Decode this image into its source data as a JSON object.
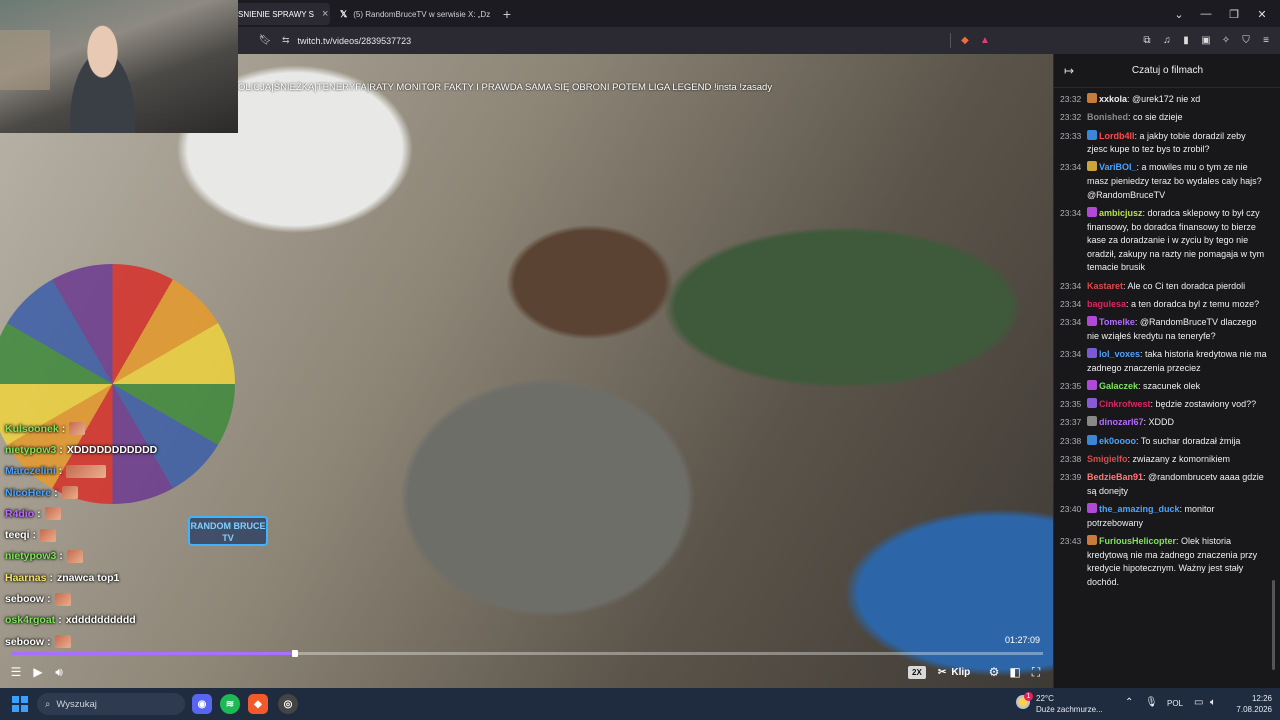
{
  "browser": {
    "tabs": [
      {
        "label": "SNIENIE SPRAWY S",
        "active": true
      },
      {
        "label": "(5) RandomBruceTV w serwisie X: „Dz",
        "active": false
      }
    ],
    "url": "twitch.tv/videos/2839537723",
    "new_tab": "+",
    "icons": [
      "bookmark-icon",
      "site-info-icon",
      "brave-shield-icon",
      "rewards-icon",
      "extensions-icon",
      "media-icon",
      "sidebar-icon",
      "wallet-icon",
      "leo-icon",
      "vpn-icon",
      "menu-icon"
    ]
  },
  "video": {
    "title": "OLICJA|ŚNIEŻKA|TENERYFA|RATY MONITOR FAKTY I PRAWDA SAMA SIĘ OBRONI POTEM LIGA LEGEND !insta !zasady",
    "neon_sign": "RANDOM BRUCE TV",
    "timestamp": "01:27:09",
    "progress_fraction": 0.275,
    "speed": "2X",
    "clip_label": "Klip",
    "overlay_chat": [
      {
        "name": "Kulsoonek",
        "color": "#7fe35c",
        "msg": "",
        "emote": "small"
      },
      {
        "name": "nietypow3",
        "color": "#7fe35c",
        "msg": "XDDDDDDDDDDD",
        "emote": ""
      },
      {
        "name": "Marczelini",
        "color": "#4aa3ff",
        "msg": "",
        "emote": "wide"
      },
      {
        "name": "NicoHere",
        "color": "#4aa3ff",
        "msg": "",
        "emote": "small"
      },
      {
        "name": "R4dio",
        "color": "#b76cff",
        "msg": "",
        "emote": "small"
      },
      {
        "name": "teeqi",
        "color": "#ffffff",
        "msg": "",
        "emote": "small"
      },
      {
        "name": "nietypow3",
        "color": "#7fe35c",
        "msg": "",
        "emote": "small"
      },
      {
        "name": "Haarnas",
        "color": "#f5e56b",
        "msg": "znawca top1",
        "emote": ""
      },
      {
        "name": "seboow",
        "color": "#ffffff",
        "msg": "",
        "emote": "small"
      },
      {
        "name": "osk4rgoat",
        "color": "#7fe35c",
        "msg": "xdddddddddd",
        "emote": ""
      },
      {
        "name": "seboow",
        "color": "#ffffff",
        "msg": "",
        "emote": "small"
      }
    ]
  },
  "chat_panel": {
    "header": "Czatuj o filmach",
    "messages": [
      {
        "time": "23:32",
        "user": "xxkola",
        "color": "#efeff1",
        "badge": "#c97b3a",
        "text": "@urek172 nie xd"
      },
      {
        "time": "23:32",
        "user": "Bonished",
        "color": "#8a8a8a",
        "badge": "",
        "text": "co sie dzieje"
      },
      {
        "time": "23:33",
        "user": "Lordb4ll",
        "color": "#ff4b4b",
        "badge": "#3b86d6",
        "text": "a jakby tobie doradzil zeby zjesc kupe to tez bys to zrobil?"
      },
      {
        "time": "23:34",
        "user": "VariBOI_",
        "color": "#4aa3ff",
        "badge": "#caa53a",
        "text": "a mowiles mu o tym ze nie masz pieniedzy teraz bo wydales caly hajs? @RandomBruceTV"
      },
      {
        "time": "23:34",
        "user": "ambicjusz",
        "color": "#b8e04a",
        "badge": "#b04ad6",
        "text": "doradca sklepowy to był czy finansowy, bo doradca finansowy to bierze kase za doradzanie i w zyciu by tego nie oradził, zakupy na razty nie pomagaja w tym temacie brusik"
      },
      {
        "time": "23:34",
        "user": "Kastaret",
        "color": "#d94a4a",
        "badge": "",
        "text": "Ale co Ci ten doradca pierdoli"
      },
      {
        "time": "23:34",
        "user": "bagulesa",
        "color": "#e0245e",
        "badge": "",
        "text": "a ten doradca byl z temu moze?"
      },
      {
        "time": "23:34",
        "user": "Tomelke",
        "color": "#b46bff",
        "badge": "#b04ad6",
        "text": "@RandomBruceTV dlaczego nie wziąłeś kredytu na teneryfe?"
      },
      {
        "time": "23:34",
        "user": "lol_voxes",
        "color": "#4aa3ff",
        "badge": "#7a5bd6",
        "text": "taka historia kredytowa nie ma zadnego znaczenia przeciez"
      },
      {
        "time": "23:35",
        "user": "Galaczek",
        "color": "#7fe35c",
        "badge": "#b04ad6",
        "text": "szacunek olek"
      },
      {
        "time": "23:35",
        "user": "Cinkrofwest",
        "color": "#e0245e",
        "badge": "#8a5bd6",
        "text": "będzie zostawiony vod??"
      },
      {
        "time": "23:37",
        "user": "dinozarl67",
        "color": "#b46bff",
        "badge": "#888888",
        "text": "XDDD"
      },
      {
        "time": "23:38",
        "user": "ek0oooo",
        "color": "#4aa3ff",
        "badge": "#3b86d6",
        "text": "To suchar doradzał żmija"
      },
      {
        "time": "23:38",
        "user": "Smigielfo",
        "color": "#d94a4a",
        "badge": "",
        "text": "zwiazany z komornikiem"
      },
      {
        "time": "23:39",
        "user": "BedzieBan91",
        "color": "#ff7a7a",
        "badge": "",
        "text": "@randombrucetv aaaa gdzie są donejty"
      },
      {
        "time": "23:40",
        "user": "the_amazing_duck",
        "color": "#4aa3ff",
        "badge": "#b04ad6",
        "text": "monitor potrzebowany"
      },
      {
        "time": "23:43",
        "user": "FuriousHelicopter",
        "color": "#7fe35c",
        "badge": "#c97b3a",
        "text": "Olek historia kredytową nie ma żadnego znaczenia przy kredycie hipotecznym. Ważny jest stały dochód."
      }
    ]
  },
  "taskbar": {
    "search_placeholder": "Wyszukaj",
    "weather_temp": "22°C",
    "weather_desc": "Duże zachmurze...",
    "weather_notif": "1",
    "lang": "POL",
    "time": "12:26",
    "date": "7.08.2026"
  },
  "colors": {
    "twitch_purple": "#a970ff",
    "chat_bg": "#18181b",
    "taskbar_bg": "#1f2b3e"
  }
}
